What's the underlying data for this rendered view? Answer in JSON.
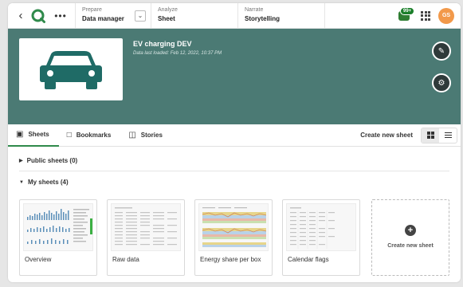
{
  "nav": {
    "back_icon": "chevron-left-icon",
    "more_icon": "more-horizontal-icon",
    "steps": [
      {
        "label": "Prepare",
        "value": "Data manager"
      },
      {
        "label": "Analyze",
        "value": "Sheet"
      },
      {
        "label": "Narrate",
        "value": "Storytelling"
      }
    ],
    "notification_badge": "99+",
    "avatar_initials": "GS",
    "accent": "#2f8a4b",
    "avatar_color": "#f2994a"
  },
  "app": {
    "title": "EV charging DEV",
    "subtitle": "Data last loaded: Feb 12, 2022, 10:37 PM",
    "banner_color": "#4b7a74",
    "thumbnail_icon": "car-icon"
  },
  "tabs": [
    {
      "label": "Sheets",
      "icon": "sheet-icon"
    },
    {
      "label": "Bookmarks",
      "icon": "bookmark-icon"
    },
    {
      "label": "Stories",
      "icon": "story-icon"
    }
  ],
  "toolbar": {
    "create_sheet_label": "Create new sheet"
  },
  "sections": {
    "public": "Public sheets (0)",
    "mine": "My sheets (4)"
  },
  "sheets": [
    {
      "title": "Overview"
    },
    {
      "title": "Raw data"
    },
    {
      "title": "Energy share per box"
    },
    {
      "title": "Calendar flags"
    }
  ],
  "new_sheet": {
    "label": "Create new sheet"
  }
}
